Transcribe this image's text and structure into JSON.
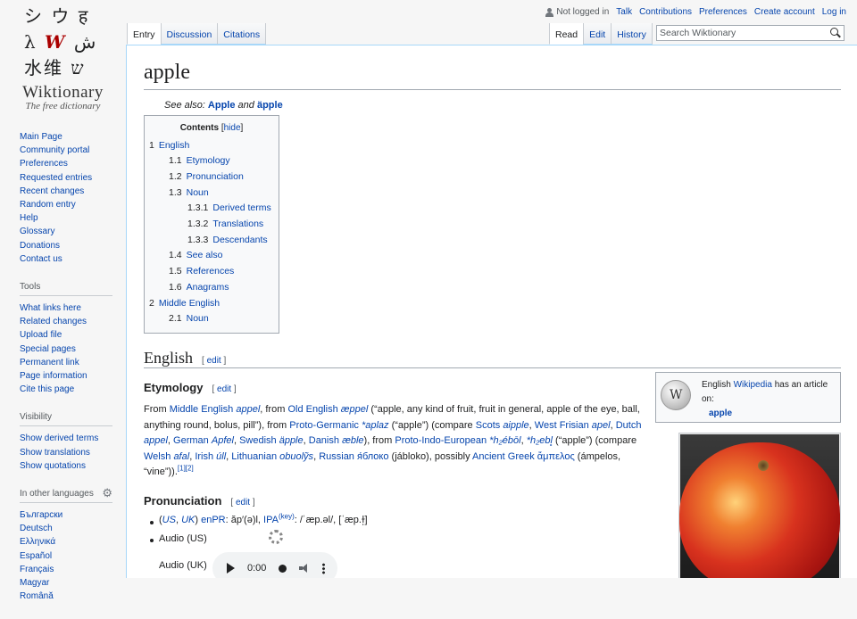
{
  "logo": {
    "glyphs": [
      "シ",
      "ウ",
      "ह",
      "λ",
      "W",
      "ش",
      "水",
      "维",
      "ש"
    ],
    "wordmark": "Wiktionary",
    "tagline": "The free dictionary"
  },
  "sidebar": {
    "navigation": [
      "Main Page",
      "Community portal",
      "Preferences",
      "Requested entries",
      "Recent changes",
      "Random entry",
      "Help",
      "Glossary",
      "Donations",
      "Contact us"
    ],
    "tools": {
      "title": "Tools",
      "items": [
        "What links here",
        "Related changes",
        "Upload file",
        "Special pages",
        "Permanent link",
        "Page information",
        "Cite this page"
      ]
    },
    "visibility": {
      "title": "Visibility",
      "items": [
        "Show derived terms",
        "Show translations",
        "Show quotations"
      ]
    },
    "languages": {
      "title": "In other languages",
      "items": [
        "Български",
        "Deutsch",
        "Ελληνικά",
        "Español",
        "Français",
        "Magyar",
        "Română"
      ]
    }
  },
  "personal": {
    "anon": "Not logged in",
    "links": [
      "Talk",
      "Contributions",
      "Preferences",
      "Create account",
      "Log in"
    ]
  },
  "tabs": {
    "left": [
      "Entry",
      "Discussion",
      "Citations"
    ],
    "right": [
      "Read",
      "Edit",
      "History"
    ]
  },
  "search": {
    "placeholder": "Search Wiktionary"
  },
  "page": {
    "title": "apple",
    "see_also": {
      "prefix": "See also: ",
      "link1": "Apple",
      "and": " and ",
      "link2": "äpple"
    }
  },
  "toc": {
    "title": "Contents",
    "hide": "hide",
    "items": [
      {
        "num": "1",
        "label": "English"
      },
      {
        "num": "1.1",
        "label": "Etymology"
      },
      {
        "num": "1.2",
        "label": "Pronunciation"
      },
      {
        "num": "1.3",
        "label": "Noun"
      },
      {
        "num": "1.3.1",
        "label": "Derived terms"
      },
      {
        "num": "1.3.2",
        "label": "Translations"
      },
      {
        "num": "1.3.3",
        "label": "Descendants"
      },
      {
        "num": "1.4",
        "label": "See also"
      },
      {
        "num": "1.5",
        "label": "References"
      },
      {
        "num": "1.6",
        "label": "Anagrams"
      },
      {
        "num": "2",
        "label": "Middle English"
      },
      {
        "num": "2.1",
        "label": "Noun"
      }
    ]
  },
  "sections": {
    "english": "English",
    "etymology": "Etymology",
    "pronunciation": "Pronunciation",
    "edit": "edit"
  },
  "wikibox": {
    "text1": "English ",
    "link": "Wikipedia",
    "text2": " has an article on:",
    "article": "apple"
  },
  "etymology": {
    "t1": "From ",
    "l1": "Middle English",
    "l1i": "appel",
    "t2": ", from ",
    "l2": "Old English",
    "l2i": "æppel",
    "t3": " (“apple, any kind of fruit, fruit in general, apple of the eye, ball, anything round, bolus, pill”), from ",
    "l3": "Proto-Germanic",
    "l3i": "*aplaz",
    "t4": " (“apple”) (compare ",
    "l4": "Scots",
    "l4i": "aipple",
    "t5": ", ",
    "l5": "West Frisian",
    "l5i": "apel",
    "t6": ", ",
    "l6": "Dutch",
    "l6i": "appel",
    "t7": ", ",
    "l7": "German",
    "l7i": "Apfel",
    "t8": ", ",
    "l8": "Swedish",
    "l8i": "äpple",
    "t9": ", ",
    "l9": "Danish",
    "l9i": "æble",
    "t10": "), from ",
    "l10": "Proto-Indo-European",
    "l10i": "*h₂ébōl",
    "t11": ", ",
    "l11i": "*h₂ebl̥",
    "t12": " (“apple”) (compare ",
    "l12": "Welsh",
    "l12i": "afal",
    "t13": ", ",
    "l13": "Irish",
    "l13i": "úll",
    "t14": ", ",
    "l14": "Lithuanian",
    "l14i": "obuolỹs",
    "t15": ", ",
    "l15": "Russian",
    "l15i": "я́блоко",
    "t16": " (jábloko), possibly ",
    "l16": "Ancient Greek",
    "l16i": "ἄμπελος",
    "t17": " (ámpelos, “vine”)).",
    "sup": "[1][2]"
  },
  "pronunciation": {
    "line1": {
      "open": "(",
      "us": "US",
      "comma": ", ",
      "uk": "UK",
      "close": ") ",
      "enpr": "enPR",
      "enpr_val": ": ăp′(ə)l, ",
      "ipa": "IPA",
      "key": "(key)",
      "ipa_val": ": /ˈæp.əl/, [ˈæp.ɫ̩]"
    },
    "audio_us": "Audio (US)",
    "audio_uk": "Audio (UK)",
    "time": "0:00"
  }
}
